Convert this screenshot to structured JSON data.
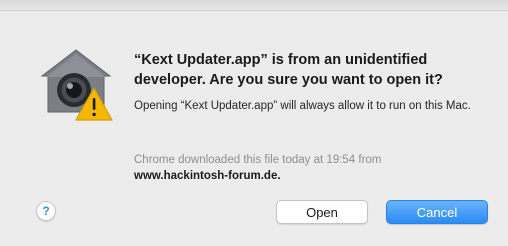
{
  "dialog": {
    "title": "“Kext Updater.app” is from an unidentified developer. Are you sure you want to open it?",
    "message": "Opening “Kext Updater.app” will always allow it to run on this Mac.",
    "source_text": "Chrome downloaded this file today at 19:54 from",
    "source_url": "www.hackintosh-forum.de."
  },
  "buttons": {
    "help_label": "?",
    "open_label": "Open",
    "cancel_label": "Cancel"
  },
  "icons": {
    "main": "gatekeeper-warning-icon",
    "help": "help-icon"
  },
  "colors": {
    "accent": "#2a8cf3",
    "warning": "#f5b800",
    "background": "#ececec"
  }
}
